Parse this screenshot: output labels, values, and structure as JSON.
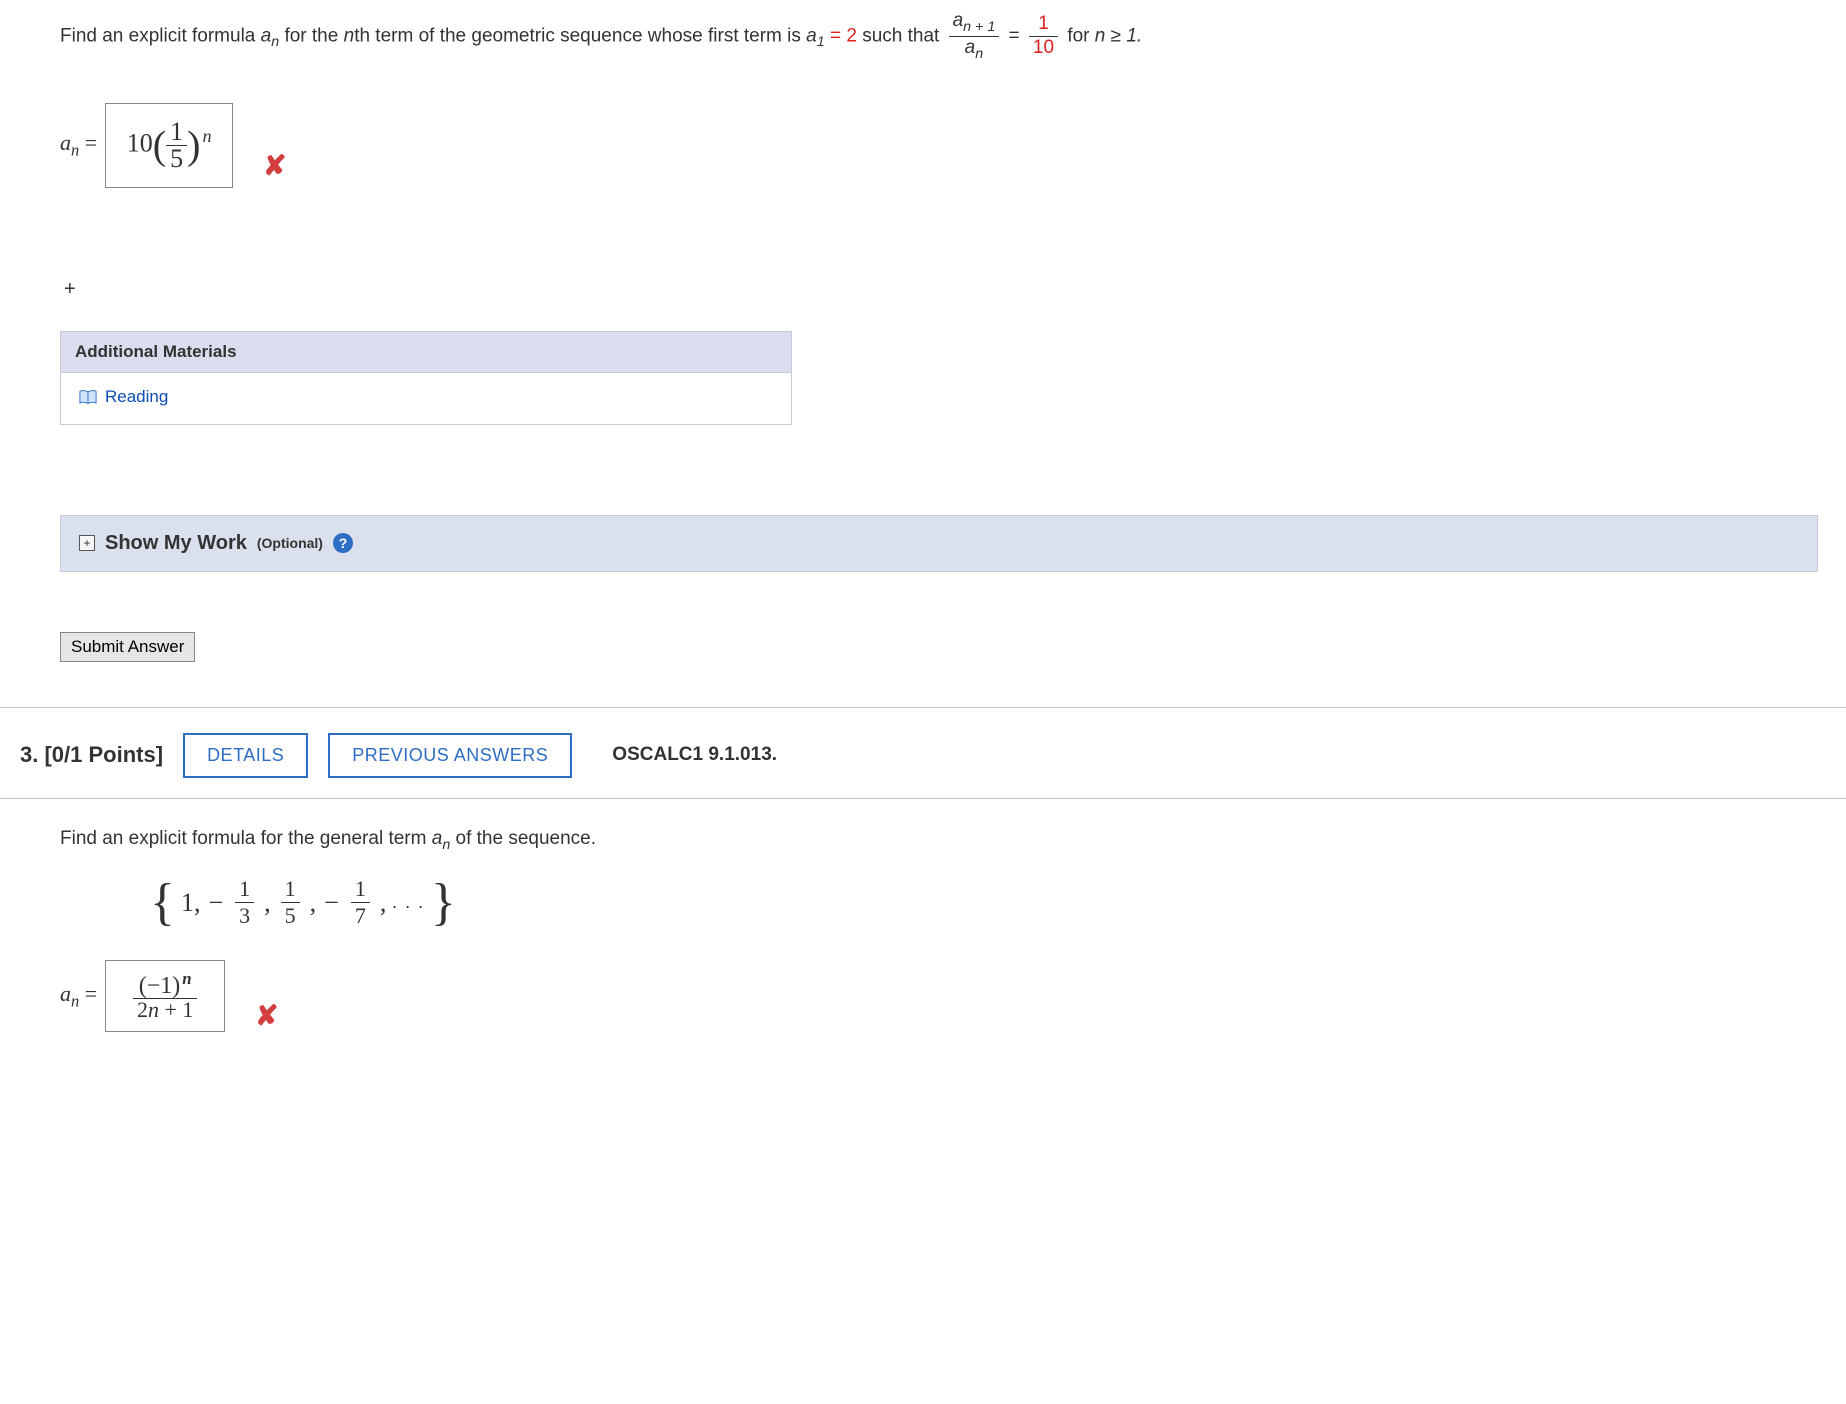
{
  "q1": {
    "prompt_pre": "Find an explicit formula ",
    "prompt_var": "a",
    "prompt_sub": "n",
    "prompt_mid1": " for the ",
    "prompt_nth": "n",
    "prompt_mid2": "th term of the geometric sequence whose first term is ",
    "a1_var": "a",
    "a1_sub": "1",
    "a1_val": " = 2",
    "prompt_mid3": " such that ",
    "ratio_num_var": "a",
    "ratio_num_sub": "n + 1",
    "ratio_den_var": "a",
    "ratio_den_sub": "n",
    "ratio_eq": " = ",
    "ratio_val_num": "1",
    "ratio_val_den": "10",
    "prompt_tail": " for ",
    "n_cond": "n ≥ 1.",
    "answer_prefix_var": "a",
    "answer_prefix_sub": "n",
    "answer_prefix_eq": " = ",
    "answer_coef": "10",
    "answer_frac_num": "1",
    "answer_frac_den": "5",
    "answer_exp": "n",
    "tutorial": "+",
    "materials_header": "Additional Materials",
    "reading_label": "Reading",
    "show_work_main": "Show My Work",
    "show_work_opt": "(Optional)",
    "submit_label": "Submit Answer"
  },
  "q2": {
    "number_label": "3.",
    "points": "[0/1 Points]",
    "details_btn": "DETAILS",
    "prev_btn": "PREVIOUS ANSWERS",
    "source": "OSCALC1 9.1.013.",
    "prompt_pre": "Find an explicit formula for the general term ",
    "prompt_var": "a",
    "prompt_sub": "n",
    "prompt_tail": " of the sequence.",
    "seq_t1": "1,",
    "seq_t2_num": "1",
    "seq_t2_den": "3",
    "seq_t3_num": "1",
    "seq_t3_den": "5",
    "seq_t4_num": "1",
    "seq_t4_den": "7",
    "seq_dots": ". . .",
    "answer_prefix_var": "a",
    "answer_prefix_sub": "n",
    "answer_prefix_eq": " = ",
    "answer_num_base": "(−1)",
    "answer_num_exp": "n",
    "answer_den_a": "2",
    "answer_den_var": "n",
    "answer_den_b": " + 1"
  }
}
